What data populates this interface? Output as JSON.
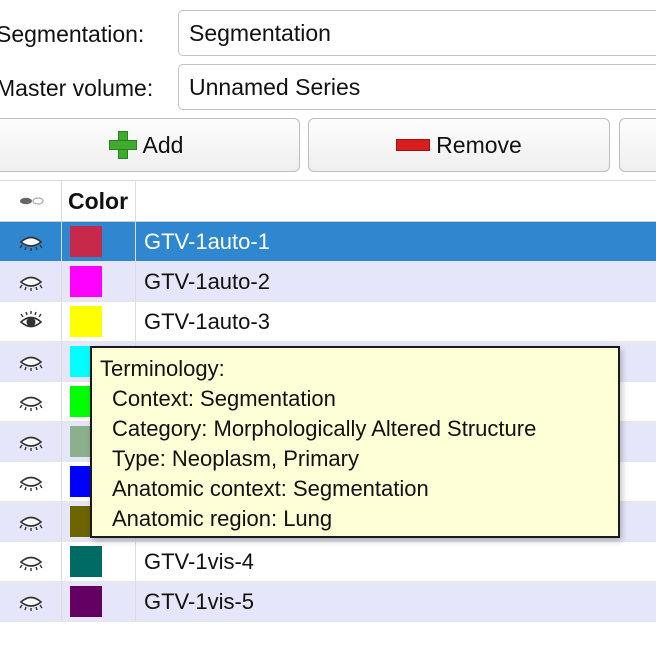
{
  "form": {
    "segmentation_label": "Segmentation:",
    "segmentation_value": "Segmentation",
    "master_volume_label": "Master volume:",
    "master_volume_value": "Unnamed Series"
  },
  "toolbar": {
    "add_label": "Add",
    "remove_label": "Remove"
  },
  "table": {
    "header_color": "Color",
    "rows": [
      {
        "name": "GTV-1auto-1",
        "color": "#c8294a",
        "selected": true,
        "visible_icon": "eye-closed-icon"
      },
      {
        "name": "GTV-1auto-2",
        "color": "#ff00ff",
        "selected": false,
        "visible_icon": "eye-closed-icon"
      },
      {
        "name": "GTV-1auto-3",
        "color": "#ffff00",
        "selected": false,
        "visible_icon": "eye-open-icon"
      },
      {
        "name": "",
        "color": "#00ffff",
        "selected": false,
        "visible_icon": "eye-closed-icon"
      },
      {
        "name": "",
        "color": "#00ff00",
        "selected": false,
        "visible_icon": "eye-closed-icon"
      },
      {
        "name": "",
        "color": "#8cb08c",
        "selected": false,
        "visible_icon": "eye-closed-icon"
      },
      {
        "name": "",
        "color": "#0000ff",
        "selected": false,
        "visible_icon": "eye-closed-icon"
      },
      {
        "name": "",
        "color": "#6e6400",
        "selected": false,
        "visible_icon": "eye-closed-icon"
      },
      {
        "name": "GTV-1vis-4",
        "color": "#006a64",
        "selected": false,
        "visible_icon": "eye-closed-icon"
      },
      {
        "name": "GTV-1vis-5",
        "color": "#640064",
        "selected": false,
        "visible_icon": "eye-closed-icon"
      }
    ]
  },
  "tooltip": {
    "title": "Terminology:",
    "context": "Context: Segmentation",
    "category": "Category: Morphologically Altered Structure",
    "type": "Type: Neoplasm, Primary",
    "anatomic_context": "Anatomic context: Segmentation",
    "anatomic_region": "Anatomic region: Lung"
  }
}
